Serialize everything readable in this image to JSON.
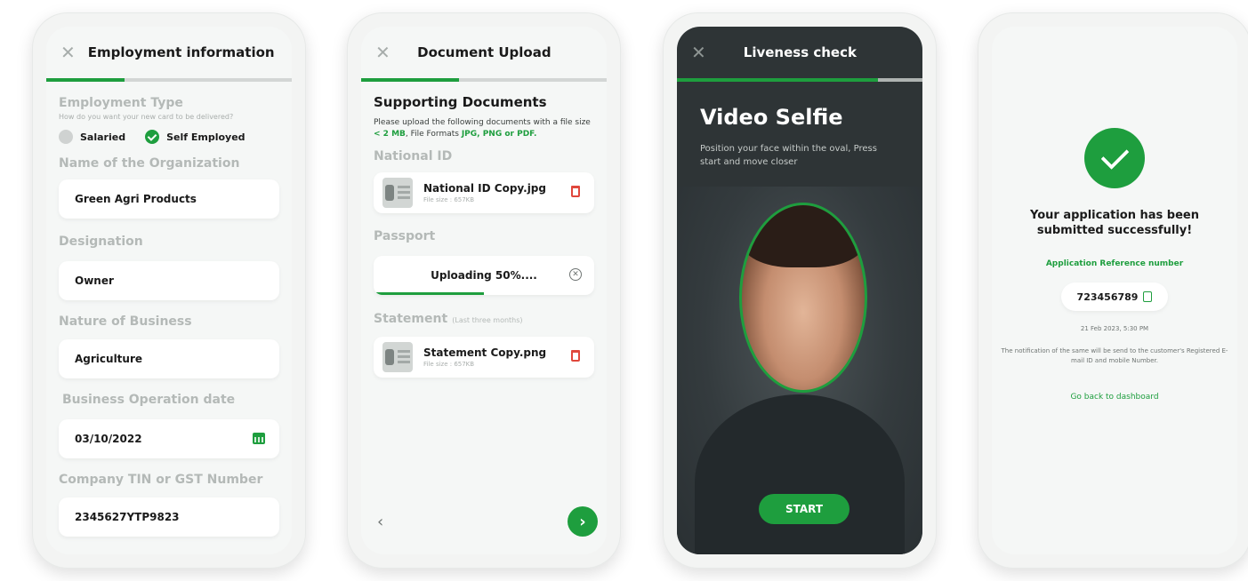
{
  "colors": {
    "accent": "#1e9e3e",
    "danger": "#e0473c",
    "dark_bg": "#2e3436"
  },
  "employment": {
    "title": "Employment information",
    "type_label": "Employment Type",
    "type_hint": "How do you want your new card to be delivered?",
    "options": [
      "Salaried",
      "Self Employed"
    ],
    "selected": "Self Employed",
    "org_label": "Name of the Organization",
    "org_value": "Green Agri Products",
    "designation_label": "Designation",
    "designation_value": "Owner",
    "nature_label": "Nature of Business",
    "nature_value": "Agriculture",
    "date_label": "Business Operation date",
    "date_value": "03/10/2022",
    "tin_label": "Company TIN or GST Number",
    "tin_value": "2345627YTP9823"
  },
  "upload": {
    "title": "Document Upload",
    "heading": "Supporting Documents",
    "desc_a": "Please upload the following documents with a file size ",
    "desc_size": "< 2 MB",
    "desc_b": ", File Formats ",
    "desc_formats": "JPG, PNG or PDF.",
    "national_label": "National ID",
    "national_file": "National ID Copy.jpg",
    "national_size": "File size : 657KB",
    "passport_label": "Passport",
    "uploading_text": "Uploading 50%....",
    "upload_progress": 0.5,
    "statement_label": "Statement",
    "statement_hint": "(Last three months)",
    "statement_file": "Statement Copy.png",
    "statement_size": "File size : 657KB",
    "back_icon": "chevron-left-icon",
    "next_icon": "chevron-right-icon"
  },
  "liveness": {
    "title": "Liveness check",
    "heading": "Video Selfie",
    "desc": "Position your face within the oval, Press start and move closer",
    "start_label": "START"
  },
  "success": {
    "message": "Your application has been submitted successfully!",
    "ref_label": "Application Reference number",
    "ref_number": "723456789",
    "timestamp": "21 Feb 2023, 5:30 PM",
    "note": "The notification of the same will be send to the customer's Registered E-mail ID and mobile Number.",
    "back_link": "Go back to dashboard"
  }
}
